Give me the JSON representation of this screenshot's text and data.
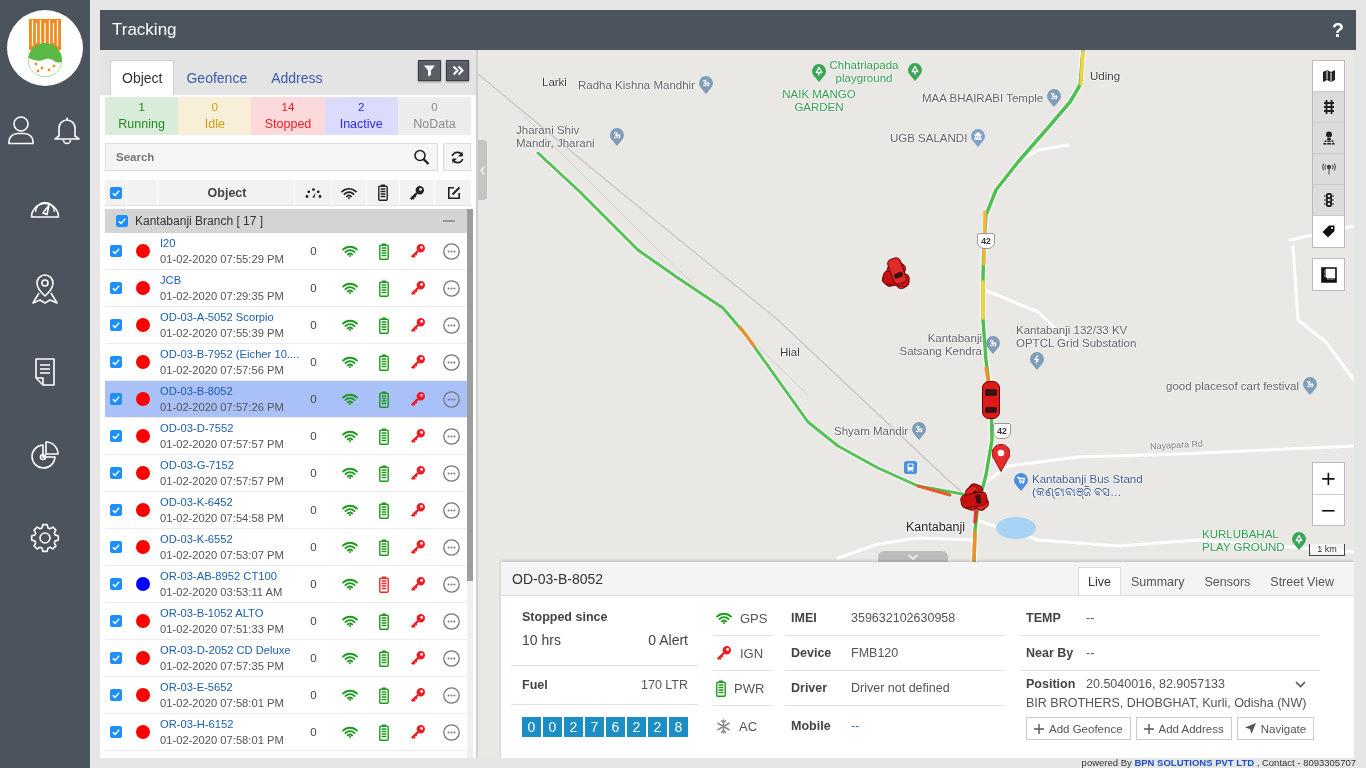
{
  "header": {
    "title": "Tracking",
    "help": "?"
  },
  "panel": {
    "tabs": [
      {
        "label": "Object",
        "selected": true
      },
      {
        "label": "Geofence",
        "selected": false
      },
      {
        "label": "Address",
        "selected": false
      }
    ],
    "status_counts": [
      {
        "count": "1",
        "label": "Running",
        "color": "#1e8c1e"
      },
      {
        "count": "0",
        "label": "Idle",
        "color": "#d29f12"
      },
      {
        "count": "14",
        "label": "Stopped",
        "color": "#f01c24"
      },
      {
        "count": "2",
        "label": "Inactive",
        "color": "#2a2ae8"
      },
      {
        "count": "0",
        "label": "NoData",
        "color": "#8c8c8c"
      }
    ],
    "search": {
      "placeholder": "Search"
    },
    "table_header": {
      "checked": true,
      "object_label": "Object"
    },
    "group": {
      "name": "Kantabanji Branch [ 17 ]",
      "checked": true,
      "expanded": true
    },
    "rows": [
      {
        "name": "I20",
        "time": "01-02-2020 07:55:29 PM",
        "speed": "0",
        "checked": true,
        "selected": false,
        "color": "#ff0000",
        "gps": true,
        "battery_low": false,
        "ignition": false
      },
      {
        "name": "JCB",
        "time": "01-02-2020 07:29:35 PM",
        "speed": "0",
        "checked": true,
        "selected": false,
        "color": "#ff0000",
        "gps": true,
        "battery_low": false,
        "ignition": false
      },
      {
        "name": "OD-03-A-5052 Scorpio",
        "time": "01-02-2020 07:55:39 PM",
        "speed": "0",
        "checked": true,
        "selected": false,
        "color": "#ff0000",
        "gps": true,
        "battery_low": false,
        "ignition": false
      },
      {
        "name": "OD-03-B-7952 (Eicher 10....",
        "time": "01-02-2020 07:57:56 PM",
        "speed": "0",
        "checked": true,
        "selected": false,
        "color": "#ff0000",
        "gps": true,
        "battery_low": false,
        "ignition": false
      },
      {
        "name": "OD-03-B-8052",
        "time": "01-02-2020 07:57:26 PM",
        "speed": "0",
        "checked": true,
        "selected": true,
        "color": "#ff0000",
        "gps": true,
        "battery_low": false,
        "ignition": false
      },
      {
        "name": "OD-03-D-7552",
        "time": "01-02-2020 07:57:57 PM",
        "speed": "0",
        "checked": true,
        "selected": false,
        "color": "#ff0000",
        "gps": true,
        "battery_low": false,
        "ignition": false
      },
      {
        "name": "OD-03-G-7152",
        "time": "01-02-2020 07:57:57 PM",
        "speed": "0",
        "checked": true,
        "selected": false,
        "color": "#ff0000",
        "gps": true,
        "battery_low": false,
        "ignition": false
      },
      {
        "name": "OD-03-K-6452",
        "time": "01-02-2020 07:54:58 PM",
        "speed": "0",
        "checked": true,
        "selected": false,
        "color": "#ff0000",
        "gps": true,
        "battery_low": false,
        "ignition": false
      },
      {
        "name": "OD-03-K-6552",
        "time": "01-02-2020 07:53:07 PM",
        "speed": "0",
        "checked": true,
        "selected": false,
        "color": "#ff0000",
        "gps": true,
        "battery_low": false,
        "ignition": false
      },
      {
        "name": "OR-03-AB-8952 CT100",
        "time": "01-02-2020 03:53:11 AM",
        "speed": "0",
        "checked": true,
        "selected": false,
        "color": "#0000ff",
        "gps": true,
        "battery_low": true,
        "ignition": false
      },
      {
        "name": "OR-03-B-1052 ALTO",
        "time": "01-02-2020 07:51:33 PM",
        "speed": "0",
        "checked": true,
        "selected": false,
        "color": "#ff0000",
        "gps": true,
        "battery_low": false,
        "ignition": false
      },
      {
        "name": "OR-03-D-2052 CD Deluxe",
        "time": "01-02-2020 07:57:35 PM",
        "speed": "0",
        "checked": true,
        "selected": false,
        "color": "#ff0000",
        "gps": true,
        "battery_low": false,
        "ignition": false
      },
      {
        "name": "OR-03-E-5652",
        "time": "01-02-2020 07:58:01 PM",
        "speed": "0",
        "checked": true,
        "selected": false,
        "color": "#ff0000",
        "gps": true,
        "battery_low": false,
        "ignition": false
      },
      {
        "name": "OR-03-H-6152",
        "time": "01-02-2020 07:58:01 PM",
        "speed": "0",
        "checked": true,
        "selected": false,
        "color": "#ff0000",
        "gps": true,
        "battery_low": false,
        "ignition": false
      }
    ]
  },
  "map": {
    "labels": [
      {
        "text": "Larki",
        "kind": "place"
      },
      {
        "text": "Radha Kishna Mandhir",
        "kind": "temple"
      },
      {
        "text": "Chhatriapada playground",
        "kind": "park"
      },
      {
        "text": "NAIK MANGO GARDEN",
        "kind": "park"
      },
      {
        "text": "Uding",
        "kind": "place"
      },
      {
        "text": "MAA BHAIRABI Temple",
        "kind": "temple"
      },
      {
        "text": "Jharani Shiv Mandir, Jharani",
        "kind": "temple"
      },
      {
        "text": "UGB SALANDI",
        "kind": "bank"
      },
      {
        "text": "Hial",
        "kind": "place"
      },
      {
        "text": "Kantabanji Satsang Kendra",
        "kind": "temple"
      },
      {
        "text": "Kantabanji 132/33 KV OPTCL Grid Substation",
        "kind": "utility"
      },
      {
        "text": "good placesof cart festival",
        "kind": "temple"
      },
      {
        "text": "Shyam Mandir",
        "kind": "temple"
      },
      {
        "text": "Kantabanji Bus Stand",
        "kind": "shop",
        "local_name": "(କଣ୍ଟାବାଞ୍ଜି ବସ…"
      },
      {
        "text": "Nayapara Rd",
        "kind": "road"
      },
      {
        "text": "Kantabanji",
        "kind": "town"
      },
      {
        "text": "KURLUBAHAL PLAY GROUND",
        "kind": "park"
      }
    ],
    "road_shields": [
      "42",
      "42"
    ],
    "layers": [
      {
        "kind": "map",
        "on": false
      },
      {
        "kind": "rail",
        "on": true
      },
      {
        "kind": "poi",
        "on": true
      },
      {
        "kind": "tower",
        "on": true
      },
      {
        "kind": "traffic",
        "on": true
      },
      {
        "kind": "tag",
        "on": false
      }
    ],
    "zoom_in": "+",
    "zoom_out": "−",
    "scale": "1 km"
  },
  "details": {
    "title": "OD-03-B-8052",
    "tabs": [
      {
        "label": "Live",
        "selected": true
      },
      {
        "label": "Summary",
        "selected": false
      },
      {
        "label": "Sensors",
        "selected": false
      },
      {
        "label": "Street View",
        "selected": false
      }
    ],
    "status_label": "Stopped since",
    "duration": "10 hrs",
    "alerts": "0 Alert",
    "fuel_label": "Fuel",
    "fuel_value": "170 LTR",
    "odometer": [
      "0",
      "0",
      "2",
      "7",
      "6",
      "2",
      "2",
      "8"
    ],
    "sensors": [
      {
        "label": "GPS",
        "kind": "gps"
      },
      {
        "label": "IGN",
        "kind": "ignition"
      },
      {
        "label": "PWR",
        "kind": "power"
      },
      {
        "label": "AC",
        "kind": "ac"
      }
    ],
    "info": [
      {
        "label": "IMEI",
        "value": "359632102630958",
        "kind": "text"
      },
      {
        "label": "Device",
        "value": "FMB120",
        "kind": "text"
      },
      {
        "label": "Driver",
        "value": "Driver not defined",
        "kind": "text"
      },
      {
        "label": "Mobile",
        "value": "--",
        "kind": "link"
      }
    ],
    "extra": [
      {
        "label": "TEMP",
        "value": "--"
      },
      {
        "label": "Near By",
        "value": "--"
      }
    ],
    "position": {
      "label": "Position",
      "coords": "20.5040016, 82.9057133",
      "address": "BIR BROTHERS, DHOBGHAT, Kurli, Odisha (NW)",
      "expanded": false
    },
    "actions": [
      {
        "label": "Add Geofence",
        "kind": "add"
      },
      {
        "label": "Add Address",
        "kind": "add"
      },
      {
        "label": "Navigate",
        "kind": "navigate"
      }
    ]
  },
  "footer": {
    "prefix": "powered By",
    "company": "BPN SOLUTIONS PVT LTD",
    "suffix": ", Contact - 8093305707"
  }
}
